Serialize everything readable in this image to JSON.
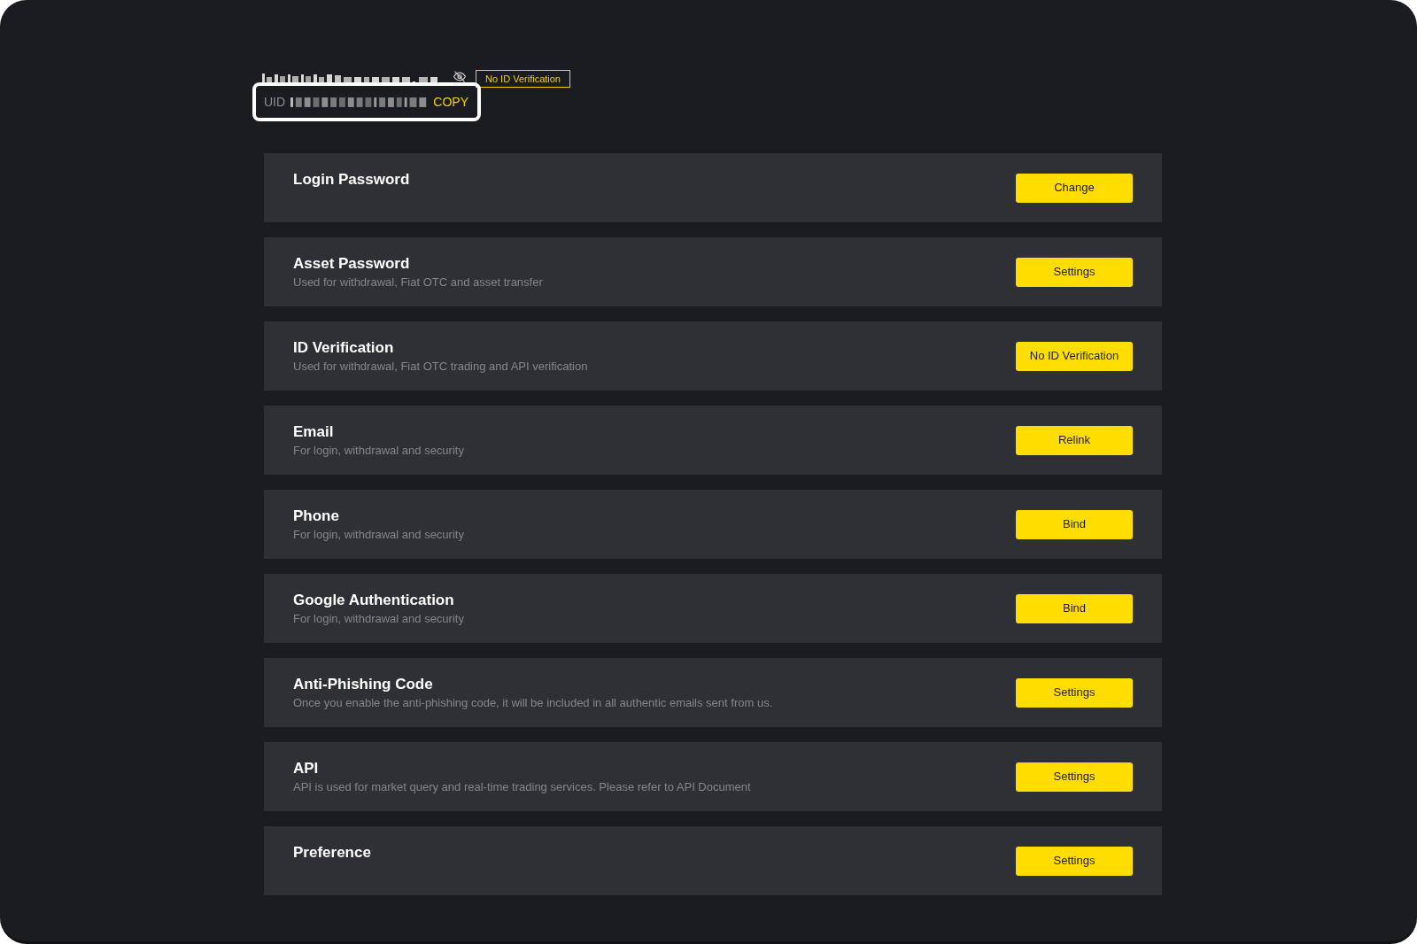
{
  "account": {
    "verification_badge": "No ID Verification",
    "uid_label": "UID",
    "copy_link": "COPY"
  },
  "settings": [
    {
      "title": "Login Password",
      "button": "Change"
    },
    {
      "title": "Asset Password",
      "description": "Used for withdrawal, Fiat OTC and asset transfer",
      "button": "Settings"
    },
    {
      "title": "ID Verification",
      "description": "Used for withdrawal, Fiat OTC trading and API verification",
      "button": "No ID Verification"
    },
    {
      "title": "Email",
      "description": "For login, withdrawal and security",
      "button": "Relink"
    },
    {
      "title": "Phone",
      "description": "For login, withdrawal and security",
      "button": "Bind"
    },
    {
      "title": "Google Authentication",
      "description": "For login, withdrawal and security",
      "button": "Bind"
    },
    {
      "title": "Anti-Phishing Code",
      "description": "Once you enable the anti-phishing code, it will be included in all authentic emails sent from us.",
      "button": "Settings"
    },
    {
      "title": "API",
      "description": "API is used for market query and real-time trading services. Please refer to API Document",
      "button": "Settings"
    },
    {
      "title": "Preference",
      "button": "Settings"
    }
  ]
}
